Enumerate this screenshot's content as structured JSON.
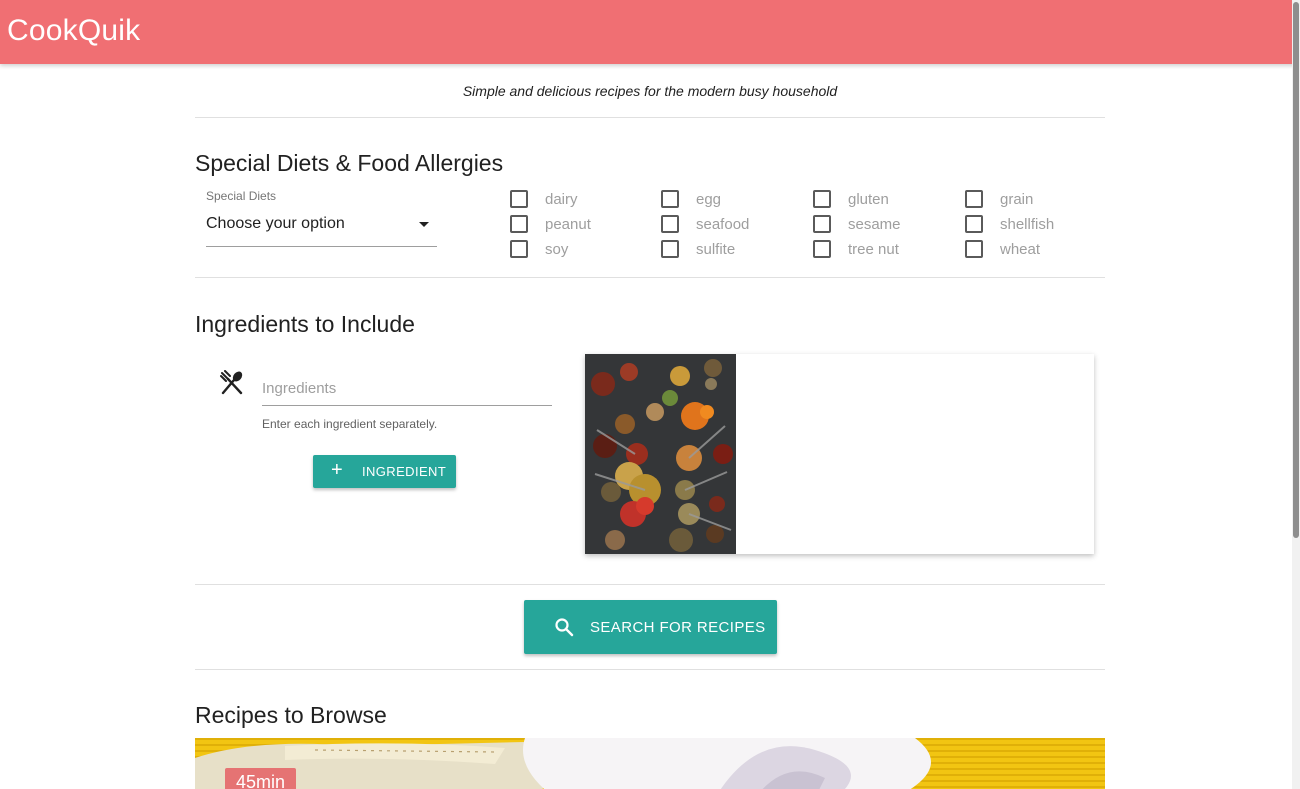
{
  "app": {
    "brand": "CookQuik",
    "tagline": "Simple and delicious recipes for the modern busy household"
  },
  "colors": {
    "navbar": "#f06f73",
    "accent": "#26a69a",
    "badge": "#e57373"
  },
  "diets": {
    "heading": "Special Diets & Food Allergies",
    "select_label": "Special Diets",
    "select_value": "Choose your option",
    "allergens": [
      {
        "label": "dairy",
        "checked": false
      },
      {
        "label": "egg",
        "checked": false
      },
      {
        "label": "gluten",
        "checked": false
      },
      {
        "label": "grain",
        "checked": false
      },
      {
        "label": "peanut",
        "checked": false
      },
      {
        "label": "seafood",
        "checked": false
      },
      {
        "label": "sesame",
        "checked": false
      },
      {
        "label": "shellfish",
        "checked": false
      },
      {
        "label": "soy",
        "checked": false
      },
      {
        "label": "sulfite",
        "checked": false
      },
      {
        "label": "tree nut",
        "checked": false
      },
      {
        "label": "wheat",
        "checked": false
      }
    ]
  },
  "ingredients": {
    "heading": "Ingredients to Include",
    "icon": "utensils-icon",
    "placeholder": "Ingredients",
    "value": "",
    "helper": "Enter each ingredient separately.",
    "add_button": "Ingredient"
  },
  "search": {
    "button": "Search for Recipes",
    "icon": "search-icon"
  },
  "browse": {
    "heading": "Recipes to Browse",
    "first_card_time": "45min"
  }
}
